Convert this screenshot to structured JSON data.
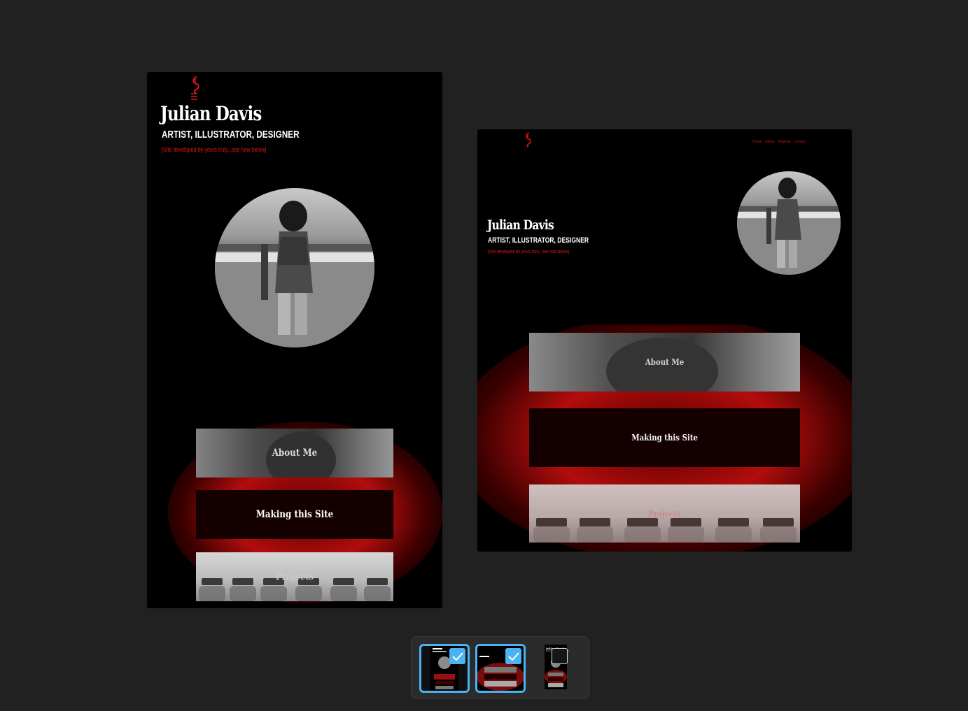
{
  "site": {
    "name": "Julian Davis",
    "subtitle": "ARTIST, ILLUSTRATOR, DESIGNER",
    "credit": "[Site developed by yours truly...see how below]",
    "sections": {
      "about": "About Me",
      "making": "Making this Site",
      "projects": "Projects"
    },
    "nav": [
      "Home",
      "About",
      "Projects",
      "Contact"
    ]
  },
  "thumb_previews": {
    "name": "Julian Davis",
    "subtitle": "ARTIST, ILLUSTRATOR, DESIGNER"
  },
  "previews": [
    {
      "id": "mobile",
      "selected": true
    },
    {
      "id": "desktop",
      "selected": true
    },
    {
      "id": "narrow",
      "selected": false
    }
  ],
  "colors": {
    "accent_red": "#e01515",
    "background": "#212121",
    "selection_blue": "#4cb3f2"
  },
  "icons": [
    "logo-icon",
    "checkmark-icon"
  ]
}
